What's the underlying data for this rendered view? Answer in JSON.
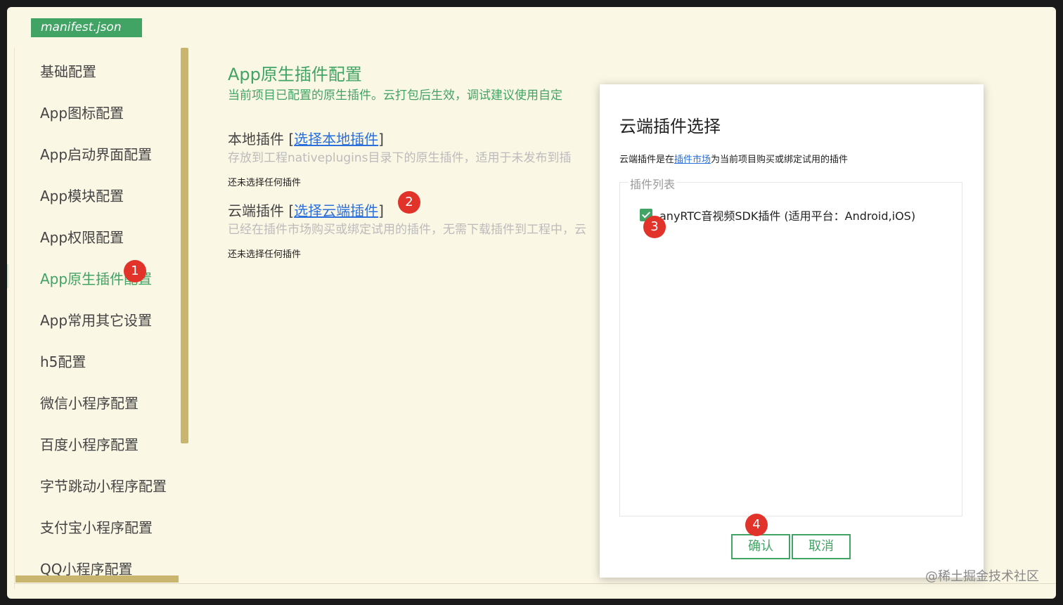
{
  "tab": {
    "label": "manifest.json"
  },
  "sidebar": {
    "items": [
      {
        "label": "基础配置"
      },
      {
        "label": "App图标配置"
      },
      {
        "label": "App启动界面配置"
      },
      {
        "label": "App模块配置"
      },
      {
        "label": "App权限配置"
      },
      {
        "label": "App原生插件配置",
        "active": true
      },
      {
        "label": "App常用其它设置"
      },
      {
        "label": "h5配置"
      },
      {
        "label": "微信小程序配置"
      },
      {
        "label": "百度小程序配置"
      },
      {
        "label": "字节跳动小程序配置"
      },
      {
        "label": "支付宝小程序配置"
      },
      {
        "label": "QQ小程序配置"
      }
    ]
  },
  "main": {
    "title": "App原生插件配置",
    "description": "当前项目已配置的原生插件。云打包后生效，调试建议使用自定",
    "local": {
      "title": "本地插件",
      "link": "选择本地插件",
      "description": "存放到工程nativeplugins目录下的原生插件，适用于未发布到插",
      "empty": "还未选择任何插件"
    },
    "cloud": {
      "title": "云端插件",
      "link": "选择云端插件",
      "description": "已经在插件市场购买或绑定试用的插件，无需下载插件到工程中，云",
      "empty": "还未选择任何插件"
    }
  },
  "dialog": {
    "title": "云端插件选择",
    "desc_prefix": "云端插件是在",
    "desc_link": "插件市场",
    "desc_suffix": "为当前项目购买或绑定试用的插件",
    "legend": "插件列表",
    "plugin": {
      "label": "anyRTC音视频SDK插件 (适用平台：Android,iOS)",
      "checked": true
    },
    "confirm": "确认",
    "cancel": "取消"
  },
  "badges": [
    "1",
    "2",
    "3",
    "4"
  ],
  "watermark": "@稀土掘金技术社区",
  "colors": {
    "accent": "#41a364",
    "link": "#2a6fdb",
    "badge": "#e2332b",
    "background": "#fbf7e5",
    "scrollbar": "#c9b56e"
  }
}
